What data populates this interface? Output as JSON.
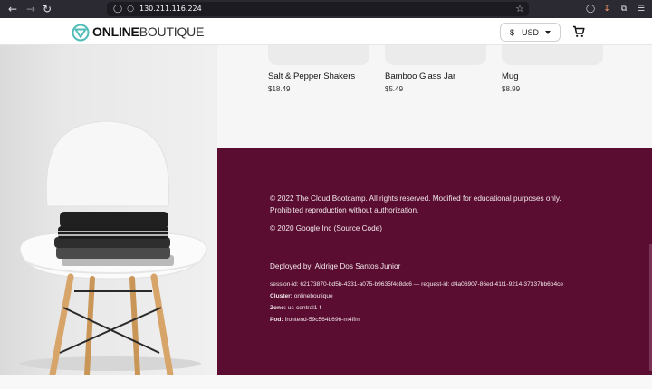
{
  "browser": {
    "url": "130.211.116.224",
    "icons": [
      "back-arrow-icon",
      "forward-arrow-icon",
      "reload-icon",
      "shield-icon",
      "lock-icon",
      "bookmark-star-icon",
      "pocket-icon",
      "download-icon",
      "extensions-icon",
      "menu-icon"
    ]
  },
  "header": {
    "logo_bold": "ONLINE",
    "logo_thin": "BOUTIQUE",
    "currency_symbol": "$",
    "currency_code": "USD",
    "accent_color": "#4fbdb9"
  },
  "products": [
    {
      "name": "Salt & Pepper Shakers",
      "price": "$18.49"
    },
    {
      "name": "Bamboo Glass Jar",
      "price": "$5.49"
    },
    {
      "name": "Mug",
      "price": "$8.99"
    }
  ],
  "footer": {
    "background_color": "#5a0d31",
    "copyright_1": "© 2022 The Cloud Bootcamp. All rights reserved. Modified for educational purposes only.",
    "copyright_2": "Prohibited reproduction without authorization.",
    "google_prefix": "© 2020 Google Inc (",
    "source_link": "Source Code",
    "google_suffix": ")",
    "deployed_by": "Deployed by: Aldrige Dos Santos Junior",
    "session_info": "session-id: 62173870-bd5b-4331-a075-b9635f4c8dc6 — request-id: d4a06907-86ed-41f1-9214-37337bb6b4ce",
    "cluster_label": "Cluster:",
    "cluster_value": " onlineboutique",
    "zone_label": "Zone:",
    "zone_value": " us-central1-f",
    "pod_label": "Pod:",
    "pod_value": " frontend-59c564b696-m4ffm"
  }
}
